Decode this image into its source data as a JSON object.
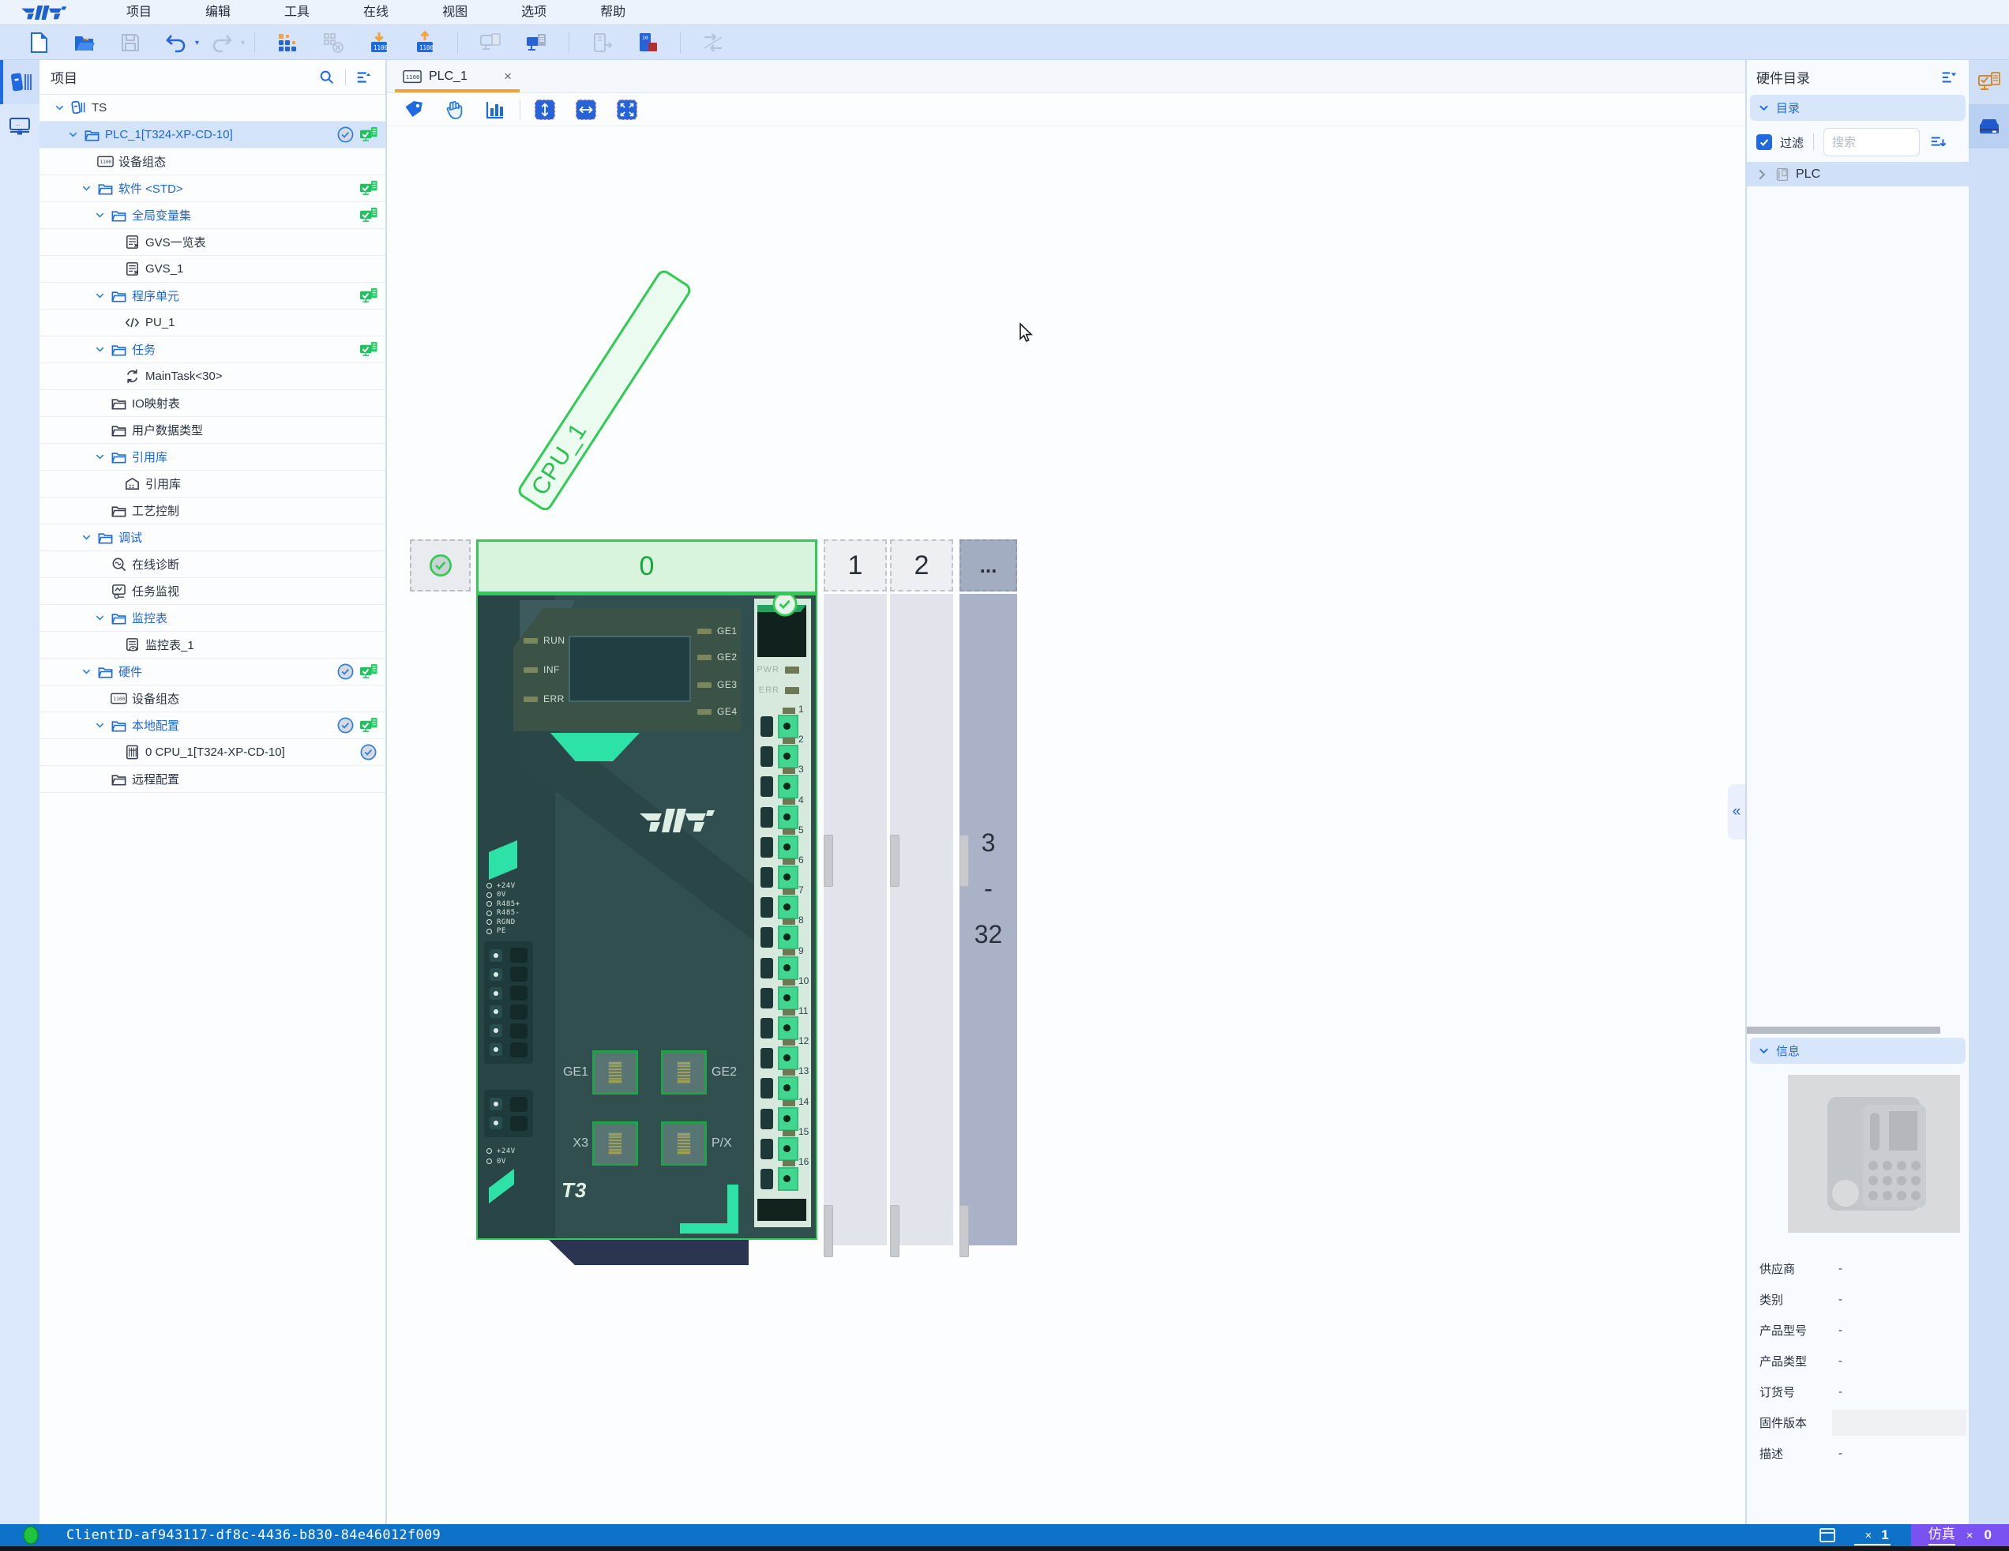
{
  "menubar": {
    "items": [
      "项目",
      "编辑",
      "工具",
      "在线",
      "视图",
      "选项",
      "帮助"
    ]
  },
  "toolbar": {
    "icons": [
      {
        "name": "new-project",
        "state": "enabled"
      },
      {
        "name": "open-project",
        "state": "enabled"
      },
      {
        "name": "save",
        "state": "disabled"
      },
      {
        "name": "undo",
        "state": "enabled",
        "dropdown": true
      },
      {
        "name": "redo",
        "state": "disabled",
        "dropdown": true
      },
      {
        "sep": true
      },
      {
        "name": "compile-grid",
        "state": "enabled"
      },
      {
        "name": "clear-grid",
        "state": "disabled"
      },
      {
        "name": "download-to-plc",
        "state": "enabled"
      },
      {
        "name": "upload-from-plc",
        "state": "enabled"
      },
      {
        "sep": true
      },
      {
        "name": "go-offline",
        "state": "disabled"
      },
      {
        "name": "go-online",
        "state": "enabled"
      },
      {
        "sep": true
      },
      {
        "name": "start-device",
        "state": "disabled"
      },
      {
        "name": "stop-device",
        "state": "enabled"
      },
      {
        "sep": true
      },
      {
        "name": "compare",
        "state": "disabled"
      }
    ]
  },
  "activity_left": [
    {
      "name": "project-explorer",
      "selected": true
    },
    {
      "name": "network-view",
      "selected": false
    }
  ],
  "sidebar": {
    "title": "项目",
    "rows": [
      {
        "label": "TS",
        "level": 0,
        "chevron": true,
        "icon": "project"
      },
      {
        "label": "PLC_1[T324-XP-CD-10]",
        "level": 1,
        "chevron": true,
        "icon": "folder",
        "blue": true,
        "selected": true,
        "badge_check": true,
        "badge_sync": true
      },
      {
        "label": "设备组态",
        "level": 2,
        "icon": "device-config"
      },
      {
        "label": "软件 <STD>",
        "level": 2,
        "chevron": true,
        "icon": "folder",
        "blue": true,
        "badge_sync": true
      },
      {
        "label": "全局变量集",
        "level": 3,
        "chevron": true,
        "icon": "folder",
        "blue": true,
        "badge_sync": true
      },
      {
        "label": "GVS一览表",
        "level": 4,
        "icon": "var-table"
      },
      {
        "label": "GVS_1",
        "level": 4,
        "icon": "var-table"
      },
      {
        "label": "程序单元",
        "level": 3,
        "chevron": true,
        "icon": "folder",
        "blue": true,
        "badge_sync": true
      },
      {
        "label": "PU_1",
        "level": 4,
        "icon": "code"
      },
      {
        "label": "任务",
        "level": 3,
        "chevron": true,
        "icon": "folder",
        "blue": true,
        "badge_sync": true
      },
      {
        "label": "MainTask<30>",
        "level": 4,
        "icon": "cycle"
      },
      {
        "label": "IO映射表",
        "level": 3,
        "icon": "folder-dark"
      },
      {
        "label": "用户数据类型",
        "level": 3,
        "icon": "folder-dark"
      },
      {
        "label": "引用库",
        "level": 3,
        "chevron": true,
        "icon": "folder",
        "blue": true
      },
      {
        "label": "引用库",
        "level": 4,
        "icon": "library"
      },
      {
        "label": "工艺控制",
        "level": 3,
        "icon": "folder-dark"
      },
      {
        "label": "调试",
        "level": 2,
        "chevron": true,
        "icon": "folder",
        "blue": true
      },
      {
        "label": "在线诊断",
        "level": 3,
        "icon": "diagnose"
      },
      {
        "label": "任务监视",
        "level": 3,
        "icon": "task-monitor"
      },
      {
        "label": "监控表",
        "level": 3,
        "chevron": true,
        "icon": "folder",
        "blue": true
      },
      {
        "label": "监控表_1",
        "level": 4,
        "icon": "watch-table"
      },
      {
        "label": "硬件",
        "level": 2,
        "chevron": true,
        "icon": "folder",
        "blue": true,
        "badge_check": true,
        "badge_sync": true
      },
      {
        "label": "设备组态",
        "level": 3,
        "icon": "device-config"
      },
      {
        "label": "本地配置",
        "level": 3,
        "chevron": true,
        "icon": "folder",
        "blue": true,
        "badge_check": true,
        "badge_sync": true
      },
      {
        "label": "0 CPU_1[T324-XP-CD-10]",
        "level": 4,
        "icon": "cpu-module",
        "badge_check": true
      },
      {
        "label": "远程配置",
        "level": 3,
        "icon": "folder-dark"
      }
    ]
  },
  "workspace": {
    "tab": {
      "label": "PLC_1"
    },
    "tools": [
      "tag",
      "pan",
      "stats",
      "sep",
      "fit-vertical",
      "fit-horizontal",
      "fit-screen"
    ],
    "device_label": "CPU_1",
    "collapse_glyph": "«",
    "rack": {
      "slots": [
        {
          "id": "0",
          "kind": "green"
        },
        {
          "id": "1",
          "kind": "dashed"
        },
        {
          "id": "2",
          "kind": "dashed"
        },
        {
          "id": "...",
          "kind": "dark"
        }
      ],
      "range": [
        "3",
        "-",
        "32"
      ]
    },
    "module": {
      "status_leds": [
        "RUN",
        "INF",
        "ERR"
      ],
      "port_leds": [
        "GE1",
        "GE2",
        "GE3",
        "GE4"
      ],
      "side_leds": [
        "PWR",
        "ERR"
      ],
      "terminals": [
        "1",
        "2",
        "3",
        "4",
        "5",
        "6",
        "7",
        "8",
        "9",
        "10",
        "11",
        "12",
        "13",
        "14",
        "15",
        "16"
      ],
      "power_terms": [
        "+24V",
        "0V",
        "R485+",
        "R485-",
        "RGND",
        "PE"
      ],
      "aux_terms": [
        "+24V",
        "0V"
      ],
      "ports": [
        "GE1",
        "GE2",
        "X3",
        "P/X"
      ],
      "brand_small": "T3"
    }
  },
  "catalog": {
    "title": "硬件目录",
    "catalog_section": "目录",
    "info_section": "信息",
    "filter_label": "过滤",
    "filter_checked": true,
    "search_placeholder": "搜索",
    "tree": [
      {
        "label": "PLC"
      }
    ],
    "info_fields": [
      {
        "label": "供应商",
        "value": "-"
      },
      {
        "label": "类别",
        "value": "-"
      },
      {
        "label": "产品型号",
        "value": "-"
      },
      {
        "label": "产品类型",
        "value": "-"
      },
      {
        "label": "订货号",
        "value": "-"
      },
      {
        "label": "固件版本",
        "value": "",
        "input": true
      },
      {
        "label": "描述",
        "value": "-"
      }
    ]
  },
  "activity_right": [
    {
      "name": "online-devices",
      "selected": false
    },
    {
      "name": "hardware-catalog",
      "selected": true
    }
  ],
  "statusbar": {
    "client_id": "ClientID-af943117-df8c-4436-b830-84e46012f009",
    "multiply": "×",
    "connection_count": "1",
    "sim_label": "仿真",
    "sim_count": "0"
  },
  "colors": {
    "accent_blue": "#1f6ae0",
    "selection_green": "#2ecc52",
    "tab_orange": "#e8a33c",
    "status_blue": "#0e72c8",
    "sim_purple": "#7a52f2",
    "module_teal": "#2ce4aa"
  }
}
